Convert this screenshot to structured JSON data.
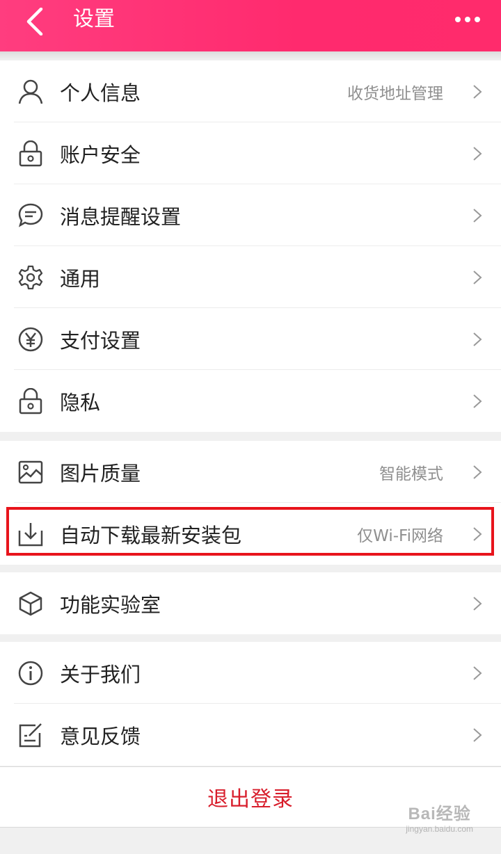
{
  "header": {
    "title": "设置"
  },
  "groups": [
    [
      {
        "label": "个人信息",
        "value": "收货地址管理",
        "icon": "person-icon"
      },
      {
        "label": "账户安全",
        "value": "",
        "icon": "lock-icon"
      },
      {
        "label": "消息提醒设置",
        "value": "",
        "icon": "message-icon"
      },
      {
        "label": "通用",
        "value": "",
        "icon": "gear-icon"
      },
      {
        "label": "支付设置",
        "value": "",
        "icon": "yen-icon"
      },
      {
        "label": "隐私",
        "value": "",
        "icon": "lock-icon"
      }
    ],
    [
      {
        "label": "图片质量",
        "value": "智能模式",
        "icon": "image-icon"
      },
      {
        "label": "自动下载最新安装包",
        "value": "仅Wi-Fi网络",
        "icon": "download-icon"
      }
    ],
    [
      {
        "label": "功能实验室",
        "value": "",
        "icon": "cube-icon"
      }
    ],
    [
      {
        "label": "关于我们",
        "value": "",
        "icon": "info-icon"
      },
      {
        "label": "意见反馈",
        "value": "",
        "icon": "feedback-icon"
      }
    ]
  ],
  "logout": {
    "label": "退出登录"
  },
  "watermark": {
    "main": "Bai经验",
    "sub": "jingyan.baidu.com"
  },
  "colors": {
    "header": "#ff2a6e",
    "logout": "#d81e2c",
    "highlight": "#e8141c"
  }
}
